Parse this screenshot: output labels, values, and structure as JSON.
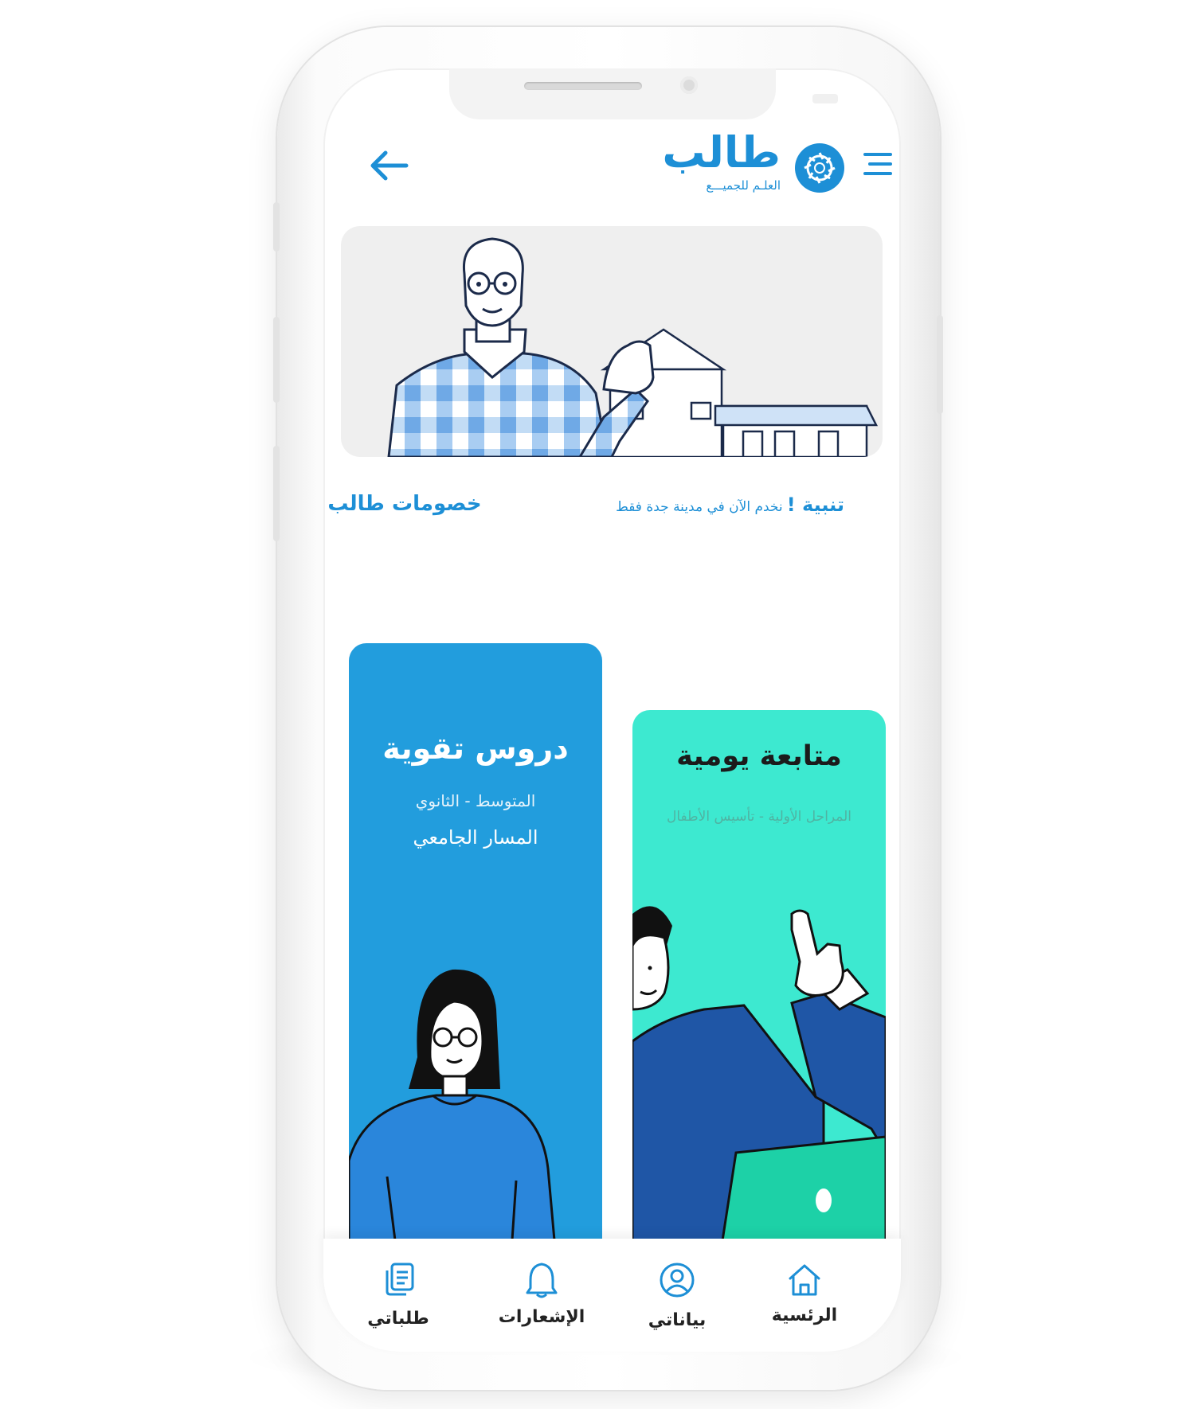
{
  "header": {
    "brand_title": "طالب",
    "brand_subtitle": "العلـم للجميـــع",
    "back_icon": "arrow-left-icon",
    "menu_icon": "hamburger-menu-icon"
  },
  "notice": {
    "label": "تنبية !",
    "text": "نخدم الآن  في  مدينة جدة  فقط"
  },
  "discounts_link": "خصومات طالب",
  "cards": {
    "tutoring": {
      "title": "دروس تقوية",
      "subtitle": "المتوسط - الثانوي",
      "subtitle2": "المسار الجامعي"
    },
    "daily": {
      "title": "متابعة يومية",
      "subtitle": "المراحل الأولية -  تأسيس الأطفال"
    }
  },
  "bottom_nav": {
    "home": "الرئسية",
    "profile": "بياناتي",
    "notifications": "الإشعارات",
    "requests": "طلباتي"
  },
  "colors": {
    "brand_blue": "#1d8fd6",
    "card_blue": "#229ddd",
    "card_green": "#3de9d0"
  }
}
